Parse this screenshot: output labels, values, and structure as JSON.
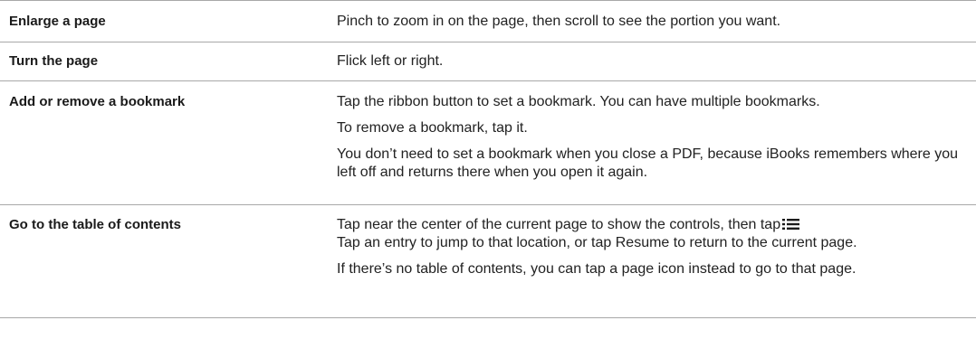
{
  "rows": [
    {
      "label": "Enlarge a page",
      "paragraphs": [
        "Pinch to zoom in on the page, then scroll to see the portion you want."
      ]
    },
    {
      "label": "Turn the page",
      "paragraphs": [
        "Flick left or right."
      ]
    },
    {
      "label": "Add or remove a bookmark",
      "paragraphs": [
        "Tap the ribbon button to set a bookmark. You can have multiple bookmarks.",
        "To remove a bookmark, tap it.",
        "You don’t need to set a bookmark when you close a PDF, because iBooks remembers where you left off and returns there when you open it again."
      ]
    },
    {
      "label": "Go to the table of contents",
      "p1_before_icon": "Tap near the center of the current page to show the controls, then tap",
      "p1_after_icon": "Tap an entry to jump to that location, or tap Resume to return to the current page.",
      "icon": "list-icon",
      "paragraphs": [
        "If there’s no table of contents, you can tap a page icon instead to go to that page."
      ]
    }
  ]
}
